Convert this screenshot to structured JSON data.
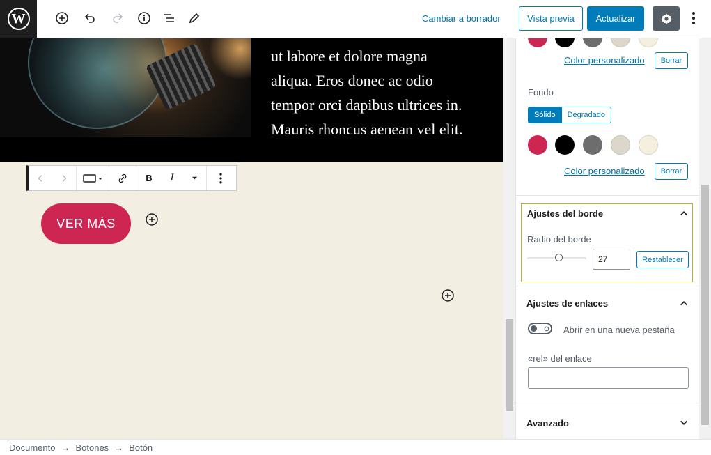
{
  "topbar": {
    "logo_text": "W",
    "draft_link": "Cambiar a borrador",
    "preview_label": "Vista previa",
    "update_label": "Actualizar"
  },
  "canvas": {
    "media_text_lines": [
      "ut labore et dolore magna",
      "aliqua. Eros donec ac odio",
      "tempor orci dapibus ultrices in.",
      "Mauris rhoncus aenean vel elit."
    ],
    "button_label": "VER MÁS",
    "toolbar": {
      "bold_label": "B",
      "italic_label": "I"
    }
  },
  "sidebar": {
    "text_color": {
      "custom_link": "Color personalizado",
      "clear_label": "Borrar"
    },
    "background": {
      "label": "Fondo",
      "solid_label": "Sólido",
      "gradient_label": "Degradado",
      "custom_link": "Color personalizado",
      "clear_label": "Borrar",
      "swatches": [
        "#cd2653",
        "#000000",
        "#6d6d6d",
        "#dcd7ca",
        "#f5efe0"
      ]
    },
    "border": {
      "title": "Ajustes del borde",
      "radius_label": "Radio del borde",
      "radius_value": "27",
      "reset_label": "Restablecer"
    },
    "links": {
      "title": "Ajustes de enlaces",
      "new_tab_label": "Abrir en una nueva pestaña",
      "rel_label": "«rel» del enlace",
      "rel_value": ""
    },
    "advanced": {
      "title": "Avanzado"
    }
  },
  "breadcrumb": {
    "items": [
      "Documento",
      "Botones",
      "Botón"
    ]
  },
  "colors": {
    "accent": "#007cba",
    "brand_button": "#cd2653",
    "canvas_bg": "#f3eee2"
  }
}
